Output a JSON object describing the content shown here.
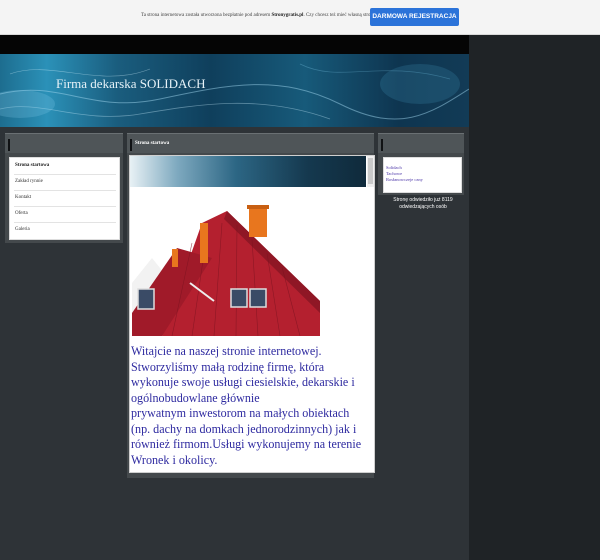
{
  "promo": {
    "text_before": "Ta strona internetowa została utworzona bezpłatnie pod adresem ",
    "site": "Stronygratis.pl",
    "text_after": ". Czy chcesz też mieć własną stronę?",
    "button_label": "DARMOWA REJESTRACJA"
  },
  "site": {
    "title": "Firma dekarska SOLIDACH"
  },
  "menu": {
    "items": [
      {
        "label": "Strona startowa"
      },
      {
        "label": "Zakład rynnie"
      },
      {
        "label": "Kontakt"
      },
      {
        "label": "Oferta"
      },
      {
        "label": "Galeria"
      }
    ]
  },
  "content": {
    "heading": "Strona startowa",
    "lines": [
      "Witajcie na naszej stronie internetowej.",
      "Stworzyliśmy małą rodzinę firmę, która wykonuje swoje usługi ciesielskie, dekarskie i ogólnobudowlane głównie",
      "prywatnym inwestorom na małych obiektach (np. dachy na domkach jednorodzinnych) jak i również firmom.Usługi wykonujemy na terenie Wronek i okolicy."
    ]
  },
  "links": {
    "items": [
      {
        "label": "Solidach"
      },
      {
        "label": "Tachowe"
      },
      {
        "label": "Rosłanowczeje czny"
      }
    ]
  },
  "counter": {
    "line1": "Stronę odwiedziło już 8119",
    "line2": "odwiedzających osób"
  },
  "colors": {
    "accent": "#2b73d9",
    "content_text": "#2e2aa0",
    "roof": "#b4202f"
  }
}
